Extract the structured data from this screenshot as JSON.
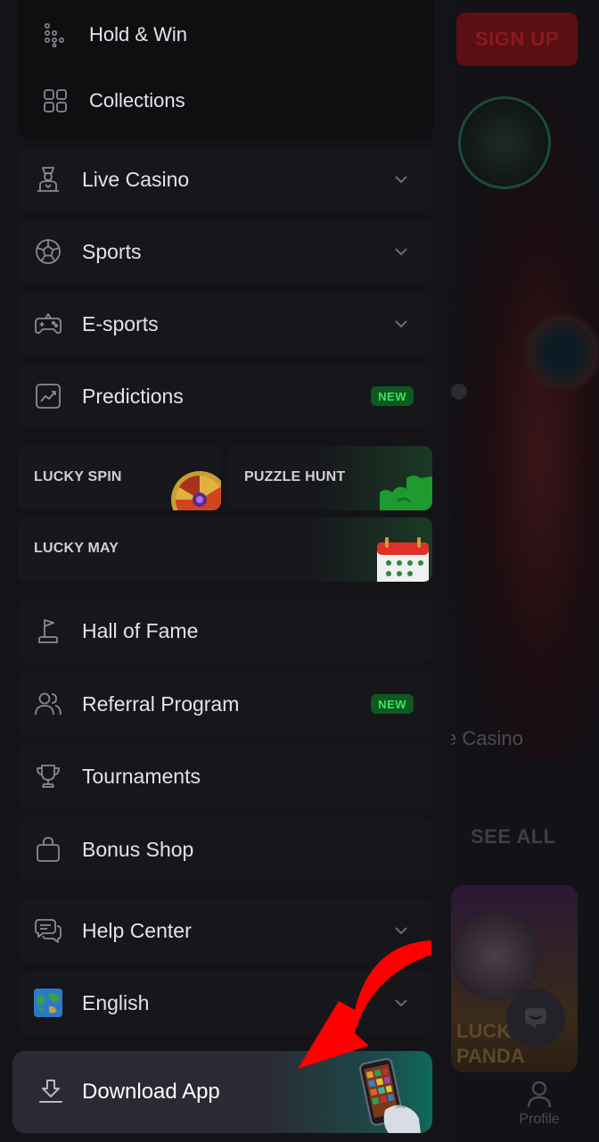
{
  "background": {
    "signup_label": "SIGN UP",
    "casino_label": "e Casino",
    "see_all_label": "SEE ALL",
    "card_text_line1": "LUCK",
    "card_text_line2": "PANDA",
    "profile_label": "Profile"
  },
  "submenu": {
    "items": [
      {
        "label": "Hold & Win",
        "icon": "dots-grid-icon"
      },
      {
        "label": "Collections",
        "icon": "squares-grid-icon"
      }
    ]
  },
  "menu": {
    "items": [
      {
        "label": "Live Casino",
        "icon": "dealer-icon",
        "expandable": true
      },
      {
        "label": "Sports",
        "icon": "soccer-ball-icon",
        "expandable": true
      },
      {
        "label": "E-sports",
        "icon": "gamepad-icon",
        "expandable": true
      },
      {
        "label": "Predictions",
        "icon": "chart-icon",
        "badge": "NEW"
      },
      {
        "label": "Hall of Fame",
        "icon": "flag-icon"
      },
      {
        "label": "Referral Program",
        "icon": "users-icon",
        "badge": "NEW"
      },
      {
        "label": "Tournaments",
        "icon": "trophy-icon"
      },
      {
        "label": "Bonus Shop",
        "icon": "shopping-bag-icon"
      },
      {
        "label": "Help Center",
        "icon": "chat-bubbles-icon",
        "expandable": true
      },
      {
        "label": "English",
        "icon": "globe-flag-icon",
        "expandable": true
      }
    ]
  },
  "promos": {
    "lucky_spin": "LUCKY SPIN",
    "puzzle_hunt": "PUZZLE HUNT",
    "lucky_may": "LUCKY MAY"
  },
  "download": {
    "label": "Download App"
  },
  "colors": {
    "accent_new_bg": "#0b5a1e",
    "accent_new_text": "#41e06a",
    "arrow": "#ff0000"
  }
}
